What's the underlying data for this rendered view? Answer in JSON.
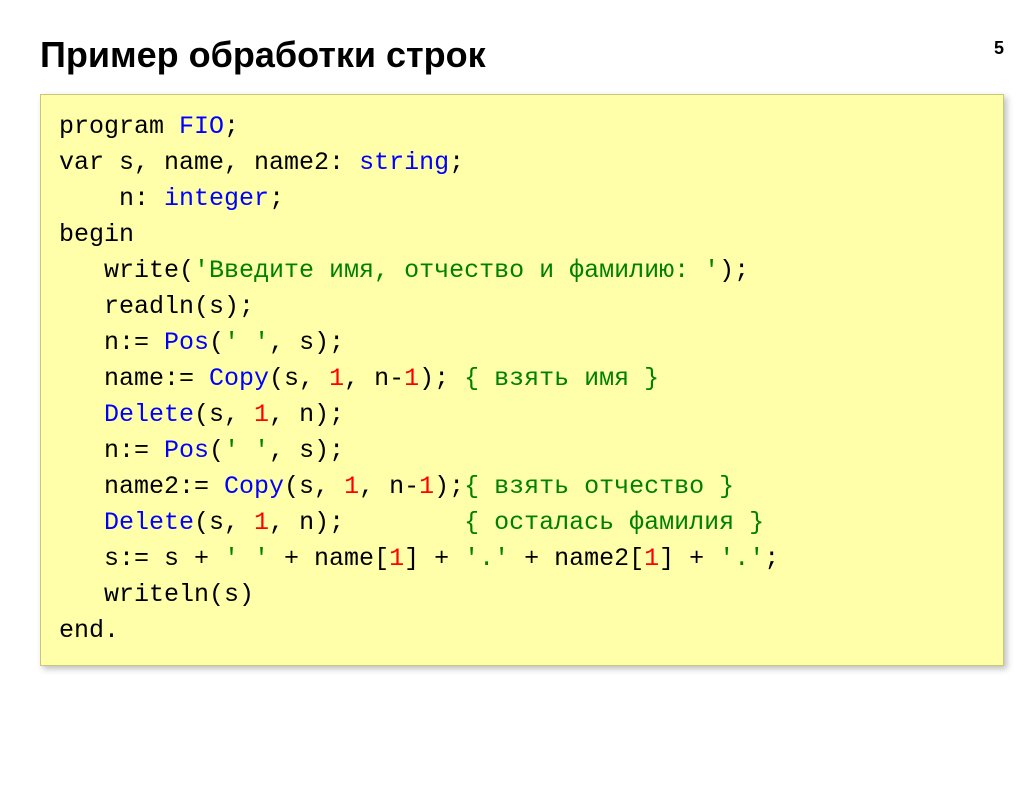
{
  "page_number": "5",
  "title": "Пример обработки строк",
  "code": {
    "l1": {
      "a": "program ",
      "b": "FIO",
      "c": ";"
    },
    "l2": {
      "a": "var s, name, name2: ",
      "b": "string",
      "c": ";"
    },
    "l3": {
      "a": "    n: ",
      "b": "integer",
      "c": ";"
    },
    "l4": {
      "a": "begin"
    },
    "l5": {
      "a": "   write(",
      "b": "'Введите имя, отчество и фамилию: '",
      "c": ");"
    },
    "l6": {
      "a": "   readln(s);"
    },
    "l7": {
      "a": "   n:= ",
      "b": "Pos",
      "c": "(",
      "d": "' '",
      "e": ", s);"
    },
    "l8": {
      "a": "   name:= ",
      "b": "Copy",
      "c": "(s, ",
      "d": "1",
      "e": ", n-",
      "f": "1",
      "g": "); ",
      "h": "{ взять имя }"
    },
    "l9": {
      "a": "   ",
      "b": "Delete",
      "c": "(s, ",
      "d": "1",
      "e": ", n);"
    },
    "l10": {
      "a": "   n:= ",
      "b": "Pos",
      "c": "(",
      "d": "' '",
      "e": ", s);"
    },
    "l11": {
      "a": "   name2:= ",
      "b": "Copy",
      "c": "(s, ",
      "d": "1",
      "e": ", n-",
      "f": "1",
      "g": ");",
      "h": "{ взять отчество }"
    },
    "l12": {
      "a": "   ",
      "b": "Delete",
      "c": "(s, ",
      "d": "1",
      "e": ", n);        ",
      "f": "{ осталась фамилия }"
    },
    "l13": {
      "a": "   s:= s + ",
      "b": "' '",
      "c": " + name[",
      "d": "1",
      "e": "] + ",
      "f": "'.'",
      "g": " + name2[",
      "h": "1",
      "i": "] + ",
      "j": "'.'",
      "k": ";"
    },
    "l14": {
      "a": "   writeln(s)"
    },
    "l15": {
      "a": "end."
    }
  }
}
